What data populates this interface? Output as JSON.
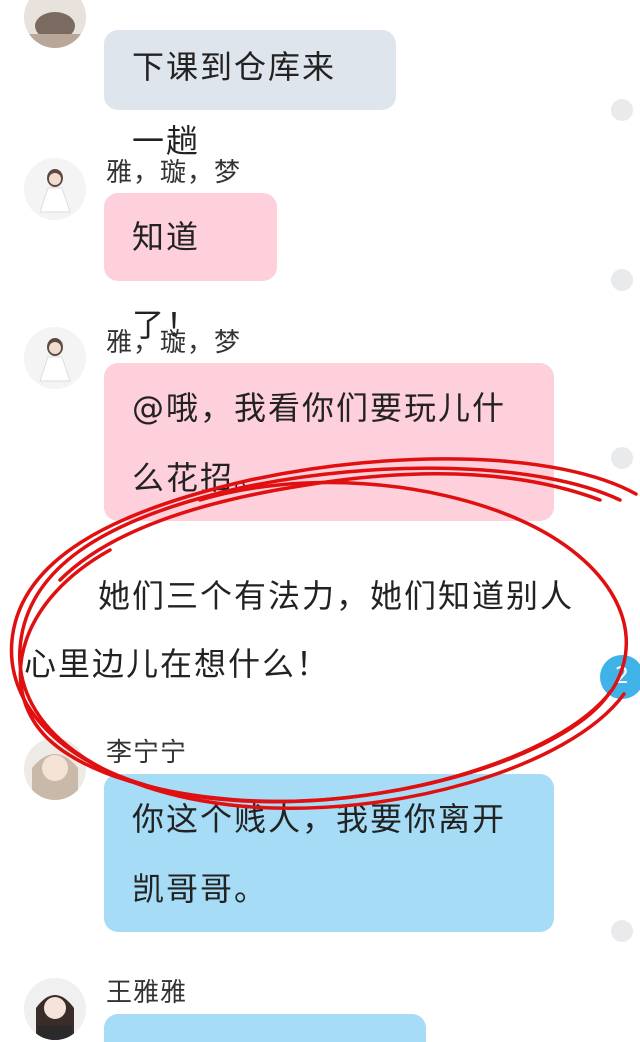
{
  "messages": [
    {
      "sender": "",
      "text": "下课到仓库来一趟"
    },
    {
      "sender": "雅，璇，梦",
      "text": "知道了！"
    },
    {
      "sender": "雅，璇，梦",
      "text": "@哦，我看你们要玩儿什么花招。"
    },
    {
      "sender": "李宁宁",
      "text": "你这个贱人，我要你离开凯哥哥。"
    },
    {
      "sender": "王雅雅",
      "text": ""
    }
  ],
  "narration": "她们三个有法力，她们知道别人心里边儿在想什么！",
  "unread_badge": "2",
  "colors": {
    "bubble_gray": "#dfe5ec",
    "bubble_pink": "#fdd0dc",
    "bubble_blue": "#a6dcf6",
    "badge": "#3fb3e8",
    "scribble": "#e01010"
  }
}
